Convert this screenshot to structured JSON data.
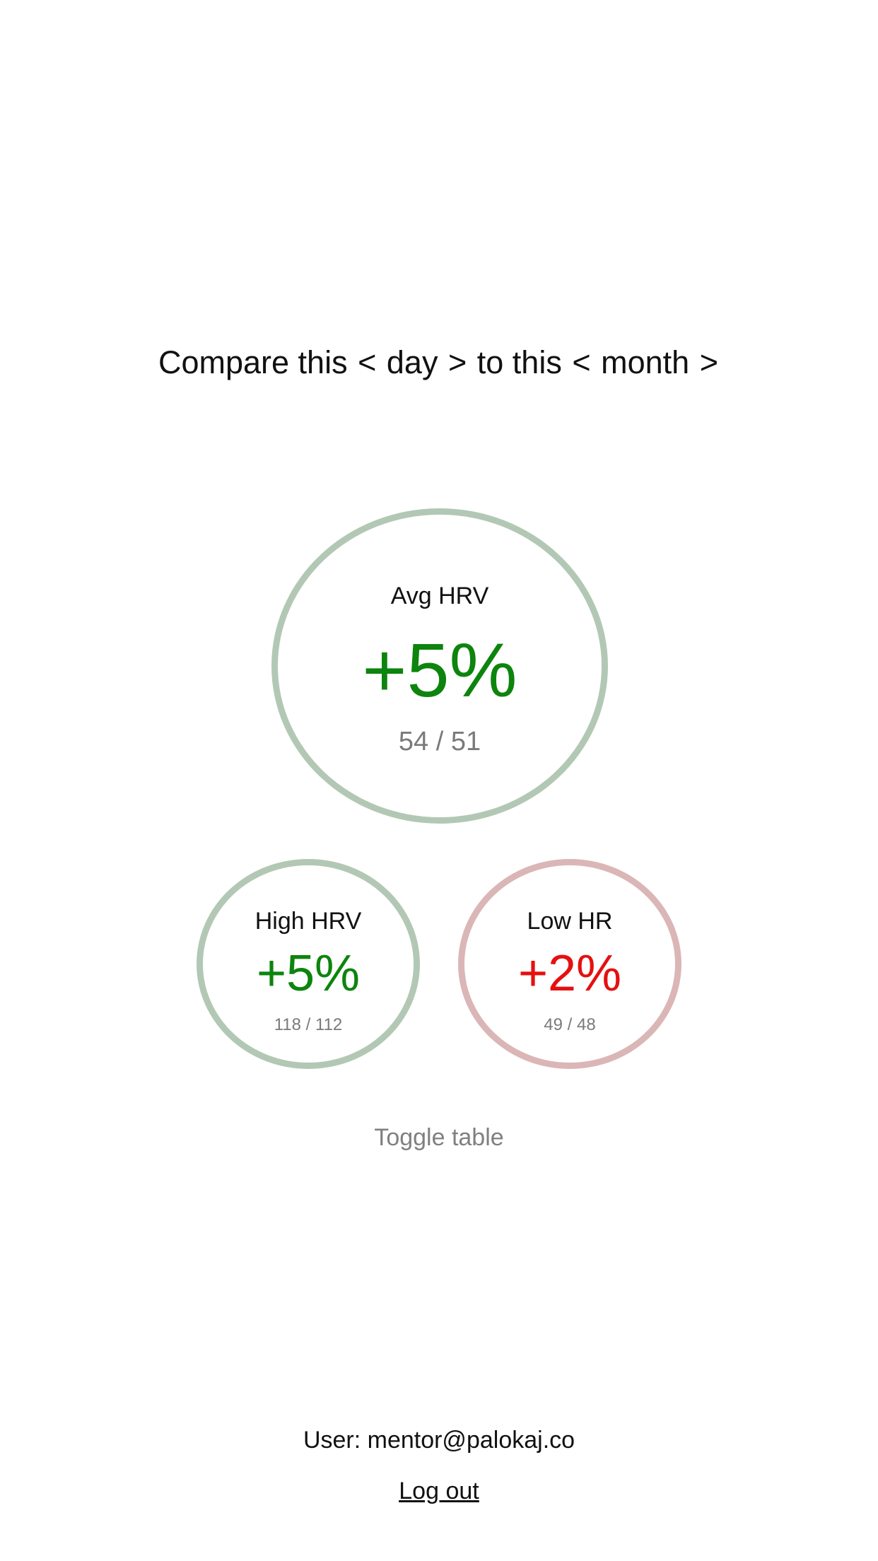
{
  "compare": {
    "prefix": "Compare this",
    "left_prev_arrow": "<",
    "left_period": "day",
    "left_next_arrow": ">",
    "middle": "to this",
    "right_prev_arrow": "<",
    "right_period": "month",
    "right_next_arrow": ">"
  },
  "metrics": {
    "avg_hrv": {
      "label": "Avg HRV",
      "change": "+5%",
      "ratio": "54 / 51",
      "status_color": "#0d840d",
      "ring_color": "#b2c8b4"
    },
    "high_hrv": {
      "label": "High HRV",
      "change": "+5%",
      "ratio": "118 / 112",
      "status_color": "#0d840d",
      "ring_color": "#b2c8b4"
    },
    "low_hr": {
      "label": "Low HR",
      "change": "+2%",
      "ratio": "49 / 48",
      "status_color": "#e51010",
      "ring_color": "#dbb6b6"
    }
  },
  "toggle_table_label": "Toggle table",
  "user": {
    "text": "User: mentor@palokaj.co"
  },
  "logout_label": "Log out"
}
